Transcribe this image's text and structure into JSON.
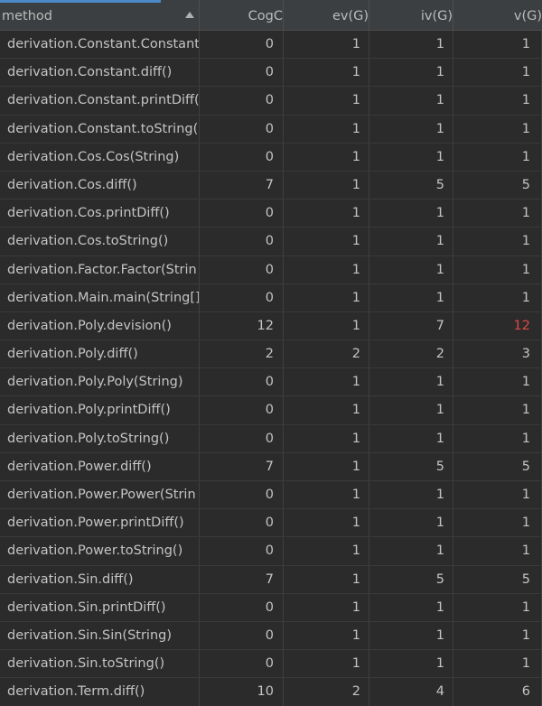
{
  "columns": [
    "method",
    "CogC",
    "ev(G)",
    "iv(G)",
    "v(G)"
  ],
  "alert_color": "#e04848",
  "rows": [
    {
      "method": "derivation.Constant.Constant",
      "cogc": "0",
      "ev": "1",
      "iv": "1",
      "v": "1",
      "v_alert": false
    },
    {
      "method": "derivation.Constant.diff()",
      "cogc": "0",
      "ev": "1",
      "iv": "1",
      "v": "1",
      "v_alert": false
    },
    {
      "method": "derivation.Constant.printDiff(",
      "cogc": "0",
      "ev": "1",
      "iv": "1",
      "v": "1",
      "v_alert": false
    },
    {
      "method": "derivation.Constant.toString(",
      "cogc": "0",
      "ev": "1",
      "iv": "1",
      "v": "1",
      "v_alert": false
    },
    {
      "method": "derivation.Cos.Cos(String)",
      "cogc": "0",
      "ev": "1",
      "iv": "1",
      "v": "1",
      "v_alert": false
    },
    {
      "method": "derivation.Cos.diff()",
      "cogc": "7",
      "ev": "1",
      "iv": "5",
      "v": "5",
      "v_alert": false
    },
    {
      "method": "derivation.Cos.printDiff()",
      "cogc": "0",
      "ev": "1",
      "iv": "1",
      "v": "1",
      "v_alert": false
    },
    {
      "method": "derivation.Cos.toString()",
      "cogc": "0",
      "ev": "1",
      "iv": "1",
      "v": "1",
      "v_alert": false
    },
    {
      "method": "derivation.Factor.Factor(Strin",
      "cogc": "0",
      "ev": "1",
      "iv": "1",
      "v": "1",
      "v_alert": false
    },
    {
      "method": "derivation.Main.main(String[]",
      "cogc": "0",
      "ev": "1",
      "iv": "1",
      "v": "1",
      "v_alert": false
    },
    {
      "method": "derivation.Poly.devision()",
      "cogc": "12",
      "ev": "1",
      "iv": "7",
      "v": "12",
      "v_alert": true
    },
    {
      "method": "derivation.Poly.diff()",
      "cogc": "2",
      "ev": "2",
      "iv": "2",
      "v": "3",
      "v_alert": false
    },
    {
      "method": "derivation.Poly.Poly(String)",
      "cogc": "0",
      "ev": "1",
      "iv": "1",
      "v": "1",
      "v_alert": false
    },
    {
      "method": "derivation.Poly.printDiff()",
      "cogc": "0",
      "ev": "1",
      "iv": "1",
      "v": "1",
      "v_alert": false
    },
    {
      "method": "derivation.Poly.toString()",
      "cogc": "0",
      "ev": "1",
      "iv": "1",
      "v": "1",
      "v_alert": false
    },
    {
      "method": "derivation.Power.diff()",
      "cogc": "7",
      "ev": "1",
      "iv": "5",
      "v": "5",
      "v_alert": false
    },
    {
      "method": "derivation.Power.Power(Strin",
      "cogc": "0",
      "ev": "1",
      "iv": "1",
      "v": "1",
      "v_alert": false
    },
    {
      "method": "derivation.Power.printDiff()",
      "cogc": "0",
      "ev": "1",
      "iv": "1",
      "v": "1",
      "v_alert": false
    },
    {
      "method": "derivation.Power.toString()",
      "cogc": "0",
      "ev": "1",
      "iv": "1",
      "v": "1",
      "v_alert": false
    },
    {
      "method": "derivation.Sin.diff()",
      "cogc": "7",
      "ev": "1",
      "iv": "5",
      "v": "5",
      "v_alert": false
    },
    {
      "method": "derivation.Sin.printDiff()",
      "cogc": "0",
      "ev": "1",
      "iv": "1",
      "v": "1",
      "v_alert": false
    },
    {
      "method": "derivation.Sin.Sin(String)",
      "cogc": "0",
      "ev": "1",
      "iv": "1",
      "v": "1",
      "v_alert": false
    },
    {
      "method": "derivation.Sin.toString()",
      "cogc": "0",
      "ev": "1",
      "iv": "1",
      "v": "1",
      "v_alert": false
    },
    {
      "method": "derivation.Term.diff()",
      "cogc": "10",
      "ev": "2",
      "iv": "4",
      "v": "6",
      "v_alert": false
    }
  ]
}
